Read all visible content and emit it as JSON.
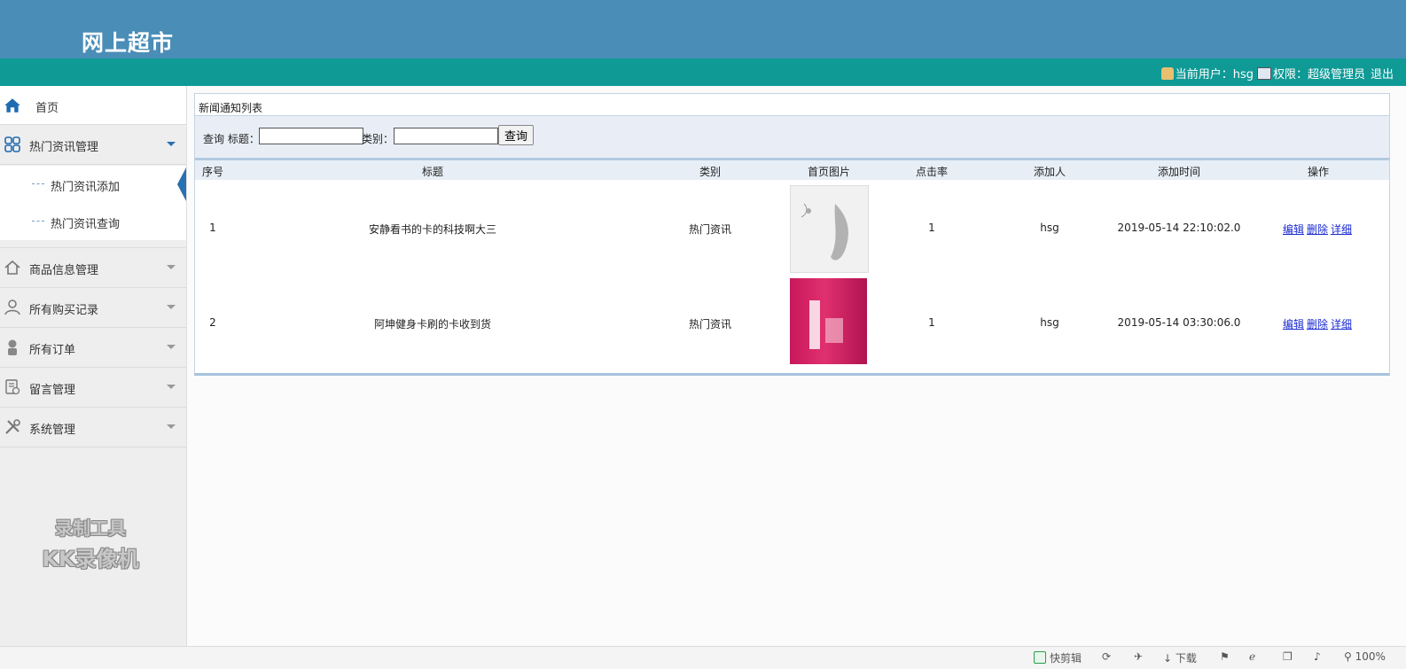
{
  "app": {
    "title": "网上超市"
  },
  "userbar": {
    "current_user_label": "当前用户：hsg",
    "role_label": "权限：超级管理员",
    "logout": "退出"
  },
  "sidebar": {
    "home": "首页",
    "groups": [
      {
        "label": "热门资讯管理",
        "expanded": true,
        "children": [
          "热门资讯添加",
          "热门资讯查询"
        ]
      },
      {
        "label": "商品信息管理"
      },
      {
        "label": "所有购买记录"
      },
      {
        "label": "所有订单"
      },
      {
        "label": "留言管理"
      },
      {
        "label": "系统管理"
      }
    ]
  },
  "watermark": {
    "line1": "录制工具",
    "line2": "KK录像机"
  },
  "panel": {
    "title": "新闻通知列表",
    "query": {
      "prefix": "查询 标题：",
      "title_value": "",
      "category_label": "类别：",
      "category_value": "",
      "button": "查询"
    },
    "columns": [
      "序号",
      "标题",
      "类别",
      "首页图片",
      "点击率",
      "添加人",
      "添加时间",
      "操作"
    ],
    "rows": [
      {
        "no": "1",
        "title": "安静看书的卡的科技啊大三",
        "category": "热门资讯",
        "clicks": "1",
        "adder": "hsg",
        "time": "2019-05-14 22:10:02.0"
      },
      {
        "no": "2",
        "title": "阿坤健身卡刷的卡收到货",
        "category": "热门资讯",
        "clicks": "1",
        "adder": "hsg",
        "time": "2019-05-14 03:30:06.0"
      }
    ],
    "actions": {
      "edit": "编辑",
      "delete": "删除",
      "detail": "详细"
    }
  },
  "statusbar": {
    "quick_edit": "快剪辑",
    "download": "下载",
    "zoom": "100%"
  },
  "colors": {
    "header": "#4a8db7",
    "userbar": "#0f9a96",
    "active_marker": "#2a6fb0",
    "link": "#1a2bd0"
  }
}
